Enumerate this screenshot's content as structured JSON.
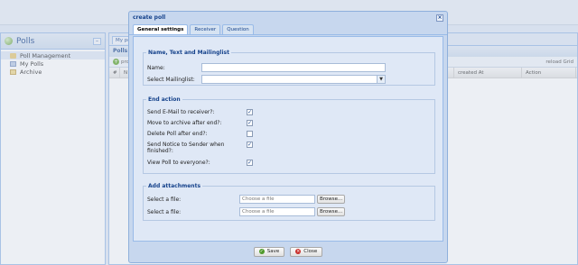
{
  "sidebar": {
    "title": "Polls",
    "items": [
      {
        "label": "Poll Management",
        "selected": true
      },
      {
        "label": "My Polls",
        "selected": false
      },
      {
        "label": "Archive",
        "selected": false
      }
    ]
  },
  "main": {
    "tab": "My po",
    "panel_title": "Polls",
    "toolbar_add": "pro",
    "reload_label": "reload Grid",
    "columns": [
      "#",
      "N",
      "created At",
      "Action"
    ]
  },
  "dialog": {
    "title": "create poll",
    "tabs": [
      "General settings",
      "Receiver",
      "Question"
    ],
    "active_tab": "General settings",
    "section_name": {
      "legend": "Name, Text and Mailinglist",
      "name_label": "Name:",
      "name_value": "",
      "mailinglist_label": "Select Mailinglist:",
      "mailinglist_value": ""
    },
    "section_end": {
      "legend": "End action",
      "options": [
        {
          "label": "Send E-Mail to receiver?:",
          "checked": true
        },
        {
          "label": "Move to archive after end?:",
          "checked": true
        },
        {
          "label": "Delete Poll after end?:",
          "checked": false
        },
        {
          "label": "Send Notice to Sender when finished?:",
          "checked": true
        },
        {
          "label": "View Poll to everyone?:",
          "checked": true
        }
      ]
    },
    "section_attach": {
      "legend": "Add attachments",
      "rows": [
        {
          "label": "Select a file:",
          "placeholder": "Choose a file",
          "button": "Browse..."
        },
        {
          "label": "Select a file:",
          "placeholder": "Choose a file",
          "button": "Browse..."
        }
      ]
    },
    "footer": {
      "save_label": "Save",
      "close_label": "Close"
    }
  }
}
